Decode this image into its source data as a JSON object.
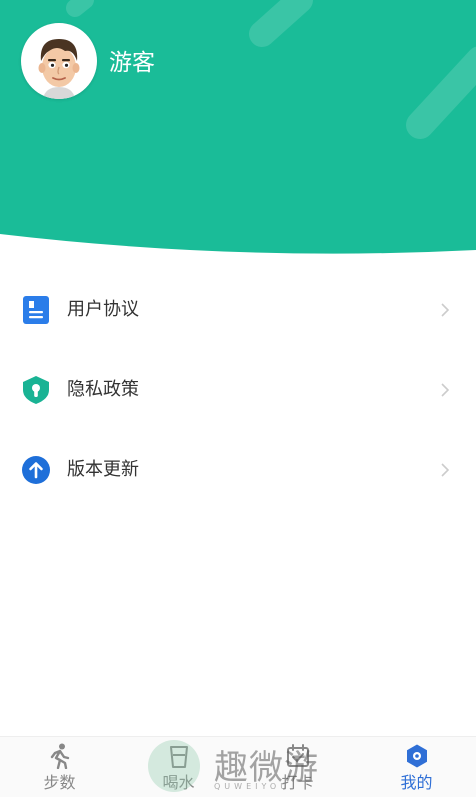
{
  "colors": {
    "header_green": "#1abc98",
    "accent_blue": "#2f6fd6",
    "agreement_icon": "#2b7de9",
    "privacy_icon": "#19b394",
    "update_icon": "#1e6fd9"
  },
  "profile": {
    "name": "游客",
    "avatar_icon": "cartoon-avatar-icon"
  },
  "menu": {
    "items": [
      {
        "label": "用户协议",
        "icon": "document-icon"
      },
      {
        "label": "隐私政策",
        "icon": "shield-lock-icon"
      },
      {
        "label": "版本更新",
        "icon": "arrow-up-circle-icon"
      }
    ]
  },
  "watermark": {
    "text": "趣微游",
    "sub": "QUWEIYOU"
  },
  "tabbar": {
    "tabs": [
      {
        "label": "步数",
        "icon": "walking-person-icon",
        "active": false
      },
      {
        "label": "喝水",
        "icon": "water-cup-icon",
        "active": false
      },
      {
        "label": "打卡",
        "icon": "check-in-icon",
        "active": false
      },
      {
        "label": "我的",
        "icon": "hexagon-gear-icon",
        "active": true
      }
    ]
  }
}
